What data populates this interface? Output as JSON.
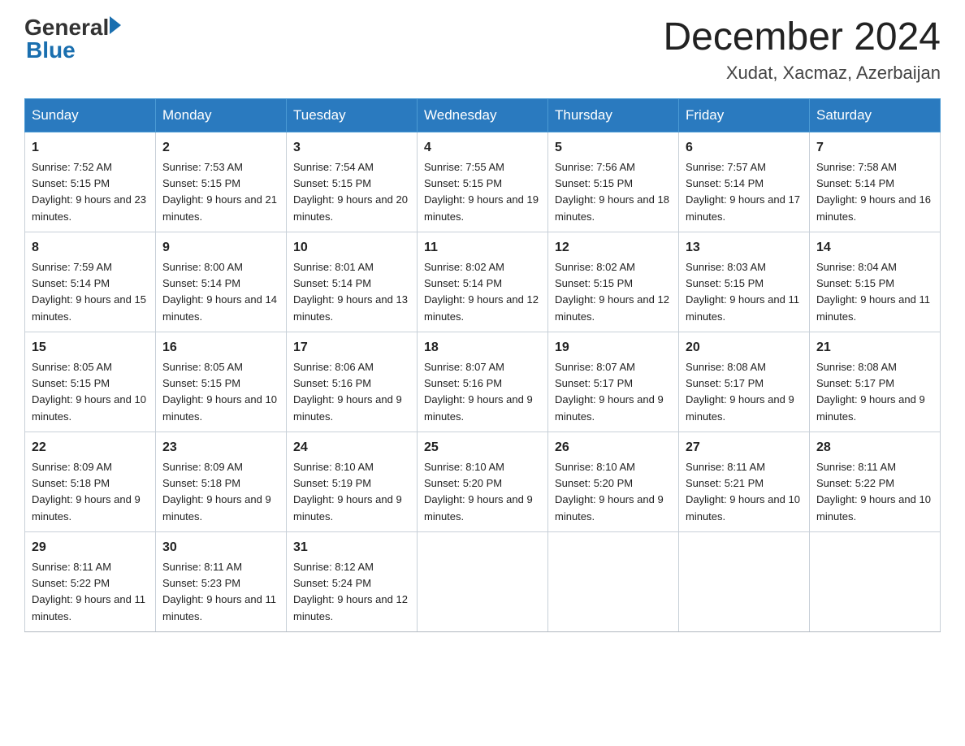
{
  "header": {
    "logo_general": "General",
    "logo_blue": "Blue",
    "month_title": "December 2024",
    "location": "Xudat, Xacmaz, Azerbaijan"
  },
  "weekdays": [
    "Sunday",
    "Monday",
    "Tuesday",
    "Wednesday",
    "Thursday",
    "Friday",
    "Saturday"
  ],
  "weeks": [
    [
      {
        "day": "1",
        "sunrise": "7:52 AM",
        "sunset": "5:15 PM",
        "daylight": "9 hours and 23 minutes."
      },
      {
        "day": "2",
        "sunrise": "7:53 AM",
        "sunset": "5:15 PM",
        "daylight": "9 hours and 21 minutes."
      },
      {
        "day": "3",
        "sunrise": "7:54 AM",
        "sunset": "5:15 PM",
        "daylight": "9 hours and 20 minutes."
      },
      {
        "day": "4",
        "sunrise": "7:55 AM",
        "sunset": "5:15 PM",
        "daylight": "9 hours and 19 minutes."
      },
      {
        "day": "5",
        "sunrise": "7:56 AM",
        "sunset": "5:15 PM",
        "daylight": "9 hours and 18 minutes."
      },
      {
        "day": "6",
        "sunrise": "7:57 AM",
        "sunset": "5:14 PM",
        "daylight": "9 hours and 17 minutes."
      },
      {
        "day": "7",
        "sunrise": "7:58 AM",
        "sunset": "5:14 PM",
        "daylight": "9 hours and 16 minutes."
      }
    ],
    [
      {
        "day": "8",
        "sunrise": "7:59 AM",
        "sunset": "5:14 PM",
        "daylight": "9 hours and 15 minutes."
      },
      {
        "day": "9",
        "sunrise": "8:00 AM",
        "sunset": "5:14 PM",
        "daylight": "9 hours and 14 minutes."
      },
      {
        "day": "10",
        "sunrise": "8:01 AM",
        "sunset": "5:14 PM",
        "daylight": "9 hours and 13 minutes."
      },
      {
        "day": "11",
        "sunrise": "8:02 AM",
        "sunset": "5:14 PM",
        "daylight": "9 hours and 12 minutes."
      },
      {
        "day": "12",
        "sunrise": "8:02 AM",
        "sunset": "5:15 PM",
        "daylight": "9 hours and 12 minutes."
      },
      {
        "day": "13",
        "sunrise": "8:03 AM",
        "sunset": "5:15 PM",
        "daylight": "9 hours and 11 minutes."
      },
      {
        "day": "14",
        "sunrise": "8:04 AM",
        "sunset": "5:15 PM",
        "daylight": "9 hours and 11 minutes."
      }
    ],
    [
      {
        "day": "15",
        "sunrise": "8:05 AM",
        "sunset": "5:15 PM",
        "daylight": "9 hours and 10 minutes."
      },
      {
        "day": "16",
        "sunrise": "8:05 AM",
        "sunset": "5:15 PM",
        "daylight": "9 hours and 10 minutes."
      },
      {
        "day": "17",
        "sunrise": "8:06 AM",
        "sunset": "5:16 PM",
        "daylight": "9 hours and 9 minutes."
      },
      {
        "day": "18",
        "sunrise": "8:07 AM",
        "sunset": "5:16 PM",
        "daylight": "9 hours and 9 minutes."
      },
      {
        "day": "19",
        "sunrise": "8:07 AM",
        "sunset": "5:17 PM",
        "daylight": "9 hours and 9 minutes."
      },
      {
        "day": "20",
        "sunrise": "8:08 AM",
        "sunset": "5:17 PM",
        "daylight": "9 hours and 9 minutes."
      },
      {
        "day": "21",
        "sunrise": "8:08 AM",
        "sunset": "5:17 PM",
        "daylight": "9 hours and 9 minutes."
      }
    ],
    [
      {
        "day": "22",
        "sunrise": "8:09 AM",
        "sunset": "5:18 PM",
        "daylight": "9 hours and 9 minutes."
      },
      {
        "day": "23",
        "sunrise": "8:09 AM",
        "sunset": "5:18 PM",
        "daylight": "9 hours and 9 minutes."
      },
      {
        "day": "24",
        "sunrise": "8:10 AM",
        "sunset": "5:19 PM",
        "daylight": "9 hours and 9 minutes."
      },
      {
        "day": "25",
        "sunrise": "8:10 AM",
        "sunset": "5:20 PM",
        "daylight": "9 hours and 9 minutes."
      },
      {
        "day": "26",
        "sunrise": "8:10 AM",
        "sunset": "5:20 PM",
        "daylight": "9 hours and 9 minutes."
      },
      {
        "day": "27",
        "sunrise": "8:11 AM",
        "sunset": "5:21 PM",
        "daylight": "9 hours and 10 minutes."
      },
      {
        "day": "28",
        "sunrise": "8:11 AM",
        "sunset": "5:22 PM",
        "daylight": "9 hours and 10 minutes."
      }
    ],
    [
      {
        "day": "29",
        "sunrise": "8:11 AM",
        "sunset": "5:22 PM",
        "daylight": "9 hours and 11 minutes."
      },
      {
        "day": "30",
        "sunrise": "8:11 AM",
        "sunset": "5:23 PM",
        "daylight": "9 hours and 11 minutes."
      },
      {
        "day": "31",
        "sunrise": "8:12 AM",
        "sunset": "5:24 PM",
        "daylight": "9 hours and 12 minutes."
      },
      null,
      null,
      null,
      null
    ]
  ]
}
